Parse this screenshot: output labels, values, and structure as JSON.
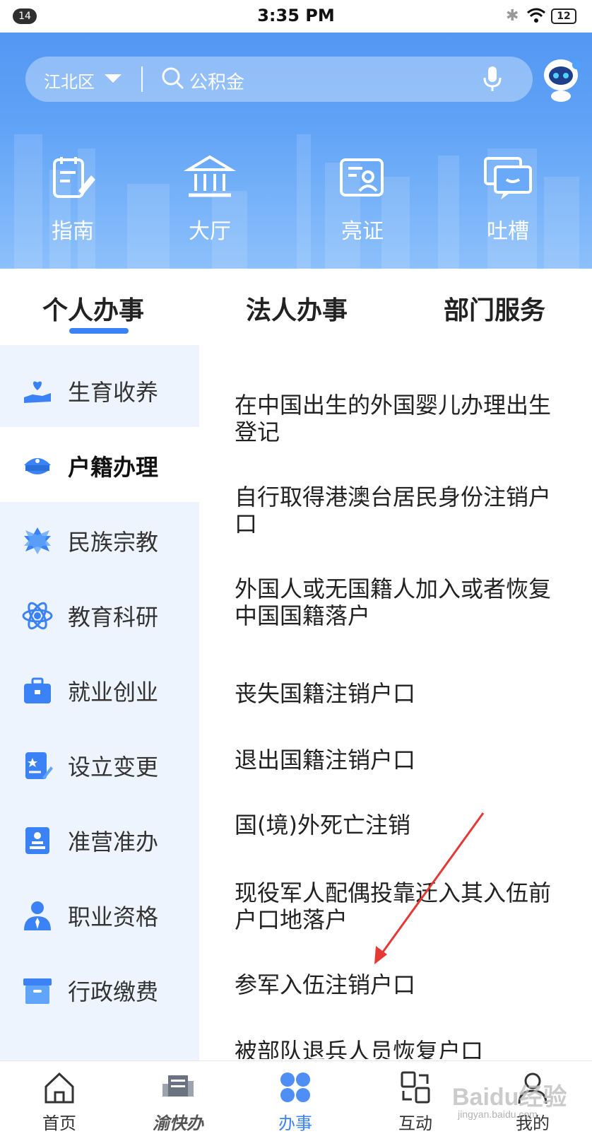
{
  "status_bar": {
    "badge": "14",
    "time": "3:35 PM",
    "battery": "12"
  },
  "search": {
    "district": "江北区",
    "query": "公积金"
  },
  "quick_actions": [
    {
      "label": "指南",
      "icon": "guide-icon"
    },
    {
      "label": "大厅",
      "icon": "hall-icon"
    },
    {
      "label": "亮证",
      "icon": "id-card-icon"
    },
    {
      "label": "吐槽",
      "icon": "feedback-chat-icon"
    }
  ],
  "tabs": [
    {
      "label": "个人办事",
      "active": true
    },
    {
      "label": "法人办事",
      "active": false
    },
    {
      "label": "部门服务",
      "active": false
    }
  ],
  "sidebar": {
    "items": [
      {
        "label": "生育收养",
        "icon": "heart-hand-icon"
      },
      {
        "label": "户籍办理",
        "icon": "police-cap-icon",
        "active": true
      },
      {
        "label": "民族宗教",
        "icon": "star-icon"
      },
      {
        "label": "教育科研",
        "icon": "atom-icon"
      },
      {
        "label": "就业创业",
        "icon": "briefcase-icon"
      },
      {
        "label": "设立变更",
        "icon": "document-edit-icon"
      },
      {
        "label": "准营准办",
        "icon": "stamp-icon"
      },
      {
        "label": "职业资格",
        "icon": "person-tie-icon"
      },
      {
        "label": "行政缴费",
        "icon": "archive-box-icon"
      }
    ]
  },
  "services": [
    {
      "line1": "在中国出生的外国婴儿办理出生",
      "line2": "登记"
    },
    {
      "line1": "自行取得港澳台居民身份注销户",
      "line2": "口"
    },
    {
      "line1": "外国人或无国籍人加入或者恢复",
      "line2": "中国国籍落户"
    },
    {
      "line1": "丧失国籍注销户口",
      "line2": ""
    },
    {
      "line1": "退出国籍注销户口",
      "line2": ""
    },
    {
      "line1": "国(境)外死亡注销",
      "line2": ""
    },
    {
      "line1": "现役军人配偶投靠迁入其入伍前",
      "line2": "户口地落户"
    },
    {
      "line1": "参军入伍注销户口",
      "line2": ""
    },
    {
      "line1": "被部队退兵人员恢复户口",
      "line2": ""
    }
  ],
  "bottom_nav": [
    {
      "label": "首页",
      "icon": "home-icon"
    },
    {
      "label": "渝快办",
      "icon": "yukuaiban-logo-icon"
    },
    {
      "label": "办事",
      "icon": "grid-dots-icon",
      "active": true
    },
    {
      "label": "互动",
      "icon": "exchange-icon"
    },
    {
      "label": "我的",
      "icon": "user-icon"
    }
  ],
  "watermark": {
    "brand": "Baidu经验",
    "url": "jingyan.baidu.com"
  },
  "colors": {
    "accent": "#3b82f6",
    "header": "#5fa2f6",
    "sidebar_bg": "#eef4fd",
    "annotation_arrow": "#e53935"
  }
}
